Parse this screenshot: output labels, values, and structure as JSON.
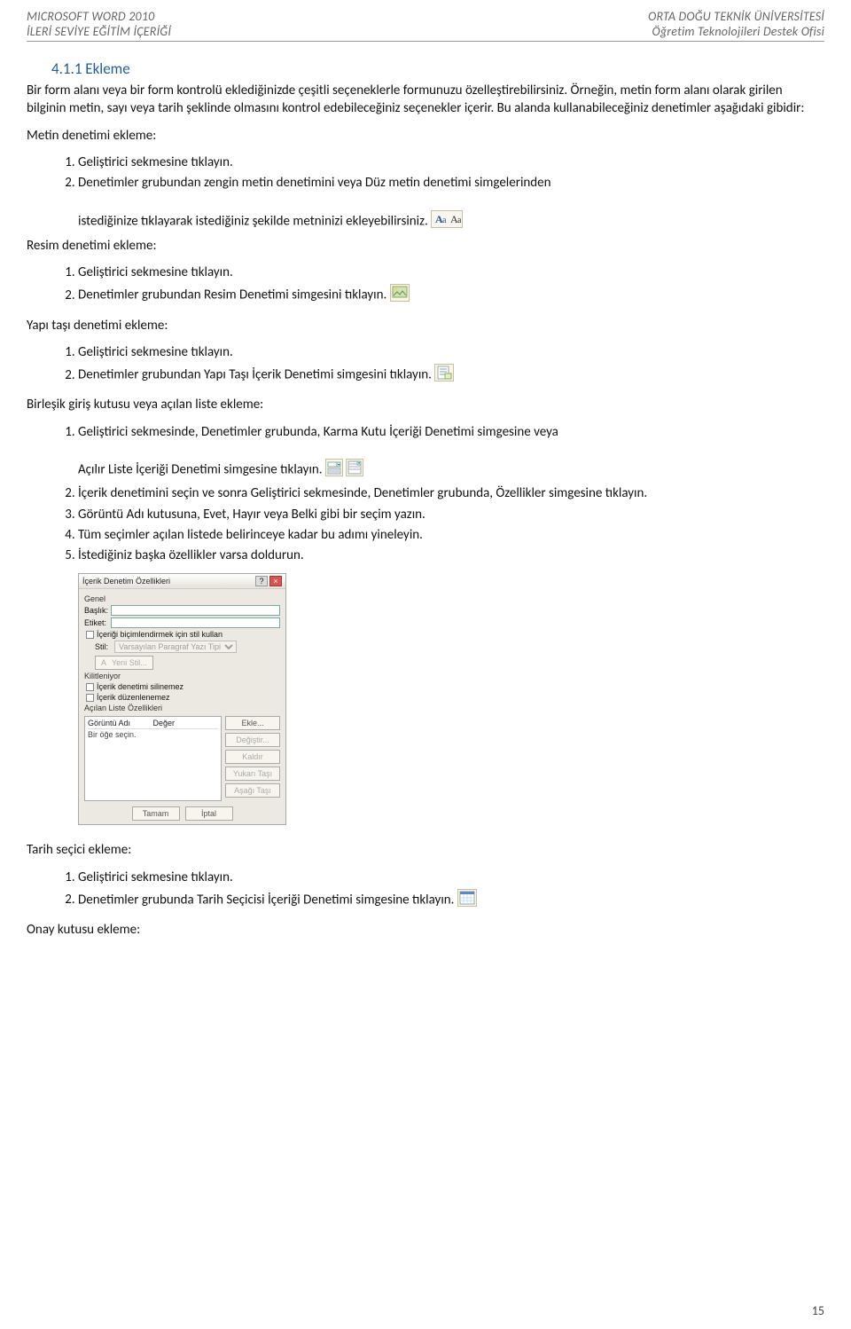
{
  "header": {
    "left_line1": "MICROSOFT WORD 2010",
    "left_line2": "İLERİ SEVİYE EĞİTİM İÇERİĞİ",
    "right_line1": "ORTA DOĞU TEKNİK ÜNİVERSİTESİ",
    "right_line2": "Öğretim Teknolojileri Destek Ofisi"
  },
  "section": {
    "number_title": "4.1.1 Ekleme",
    "intro": "Bir form alanı veya bir form kontrolü eklediğinizde çeşitli seçeneklerle formunuzu özelleştirebilirsiniz. Örneğin, metin form alanı olarak girilen bilginin metin, sayı veya tarih şeklinde olmasını kontrol edebileceğiniz seçenekler içerir. Bu alanda kullanabileceğiniz denetimler aşağıdaki gibidir:"
  },
  "metin": {
    "heading": "Metin denetimi ekleme:",
    "item1": "Geliştirici sekmesine tıklayın.",
    "item2_a": "Denetimler grubundan zengin metin denetimini veya Düz metin denetimi simgelerinden",
    "item2_b": "istediğinize tıklayarak istediğiniz şekilde metninizi ekleyebilirsiniz."
  },
  "resim": {
    "heading": "Resim denetimi ekleme:",
    "item1": "Geliştirici sekmesine tıklayın.",
    "item2": "Denetimler grubundan Resim Denetimi simgesini tıklayın."
  },
  "yapi": {
    "heading": "Yapı taşı denetimi ekleme:",
    "item1": "Geliştirici sekmesine tıklayın.",
    "item2": "Denetimler grubundan Yapı Taşı İçerik Denetimi simgesini tıklayın."
  },
  "birlesik": {
    "heading": "Birleşik giriş kutusu veya açılan liste ekleme:",
    "item1_a": "Geliştirici sekmesinde, Denetimler grubunda, Karma Kutu İçeriği Denetimi simgesine veya",
    "item1_b": "Açılır Liste İçeriği Denetimi simgesine tıklayın.",
    "item2": "İçerik denetimini seçin ve sonra Geliştirici sekmesinde, Denetimler grubunda, Özellikler simgesine tıklayın.",
    "item3": "Görüntü Adı kutusuna, Evet, Hayır veya Belki gibi bir seçim yazın.",
    "item4": "Tüm seçimler açılan listede belirinceye kadar bu adımı yineleyin.",
    "item5": "İstediğiniz başka özellikler varsa doldurun."
  },
  "dialog": {
    "title": "İçerik Denetim Özellikleri",
    "grp_genel": "Genel",
    "lbl_baslik": "Başlık:",
    "lbl_etiket": "Etiket:",
    "chk_stil": "İçeriği biçimlendirmek için stil kullan",
    "lbl_stil_sel": "Stil:",
    "stil_opt": "Varsayılan Paragraf Yazı Tipi",
    "btn_yeni_stil": "Yeni Stil...",
    "grp_kilit": "Kilitleniyor",
    "chk_silinemez": "İçerik denetimi silinemez",
    "chk_duzen": "İçerik düzenlenemez",
    "grp_acilan": "Açılan Liste Özellikleri",
    "col_ad": "Görüntü Adı",
    "col_deger": "Değer",
    "row_hint": "Bir öğe seçin.",
    "btn_ekle": "Ekle...",
    "btn_degistir": "Değiştir...",
    "btn_kaldir": "Kaldır",
    "btn_yukari": "Yukarı Taşı",
    "btn_asagi": "Aşağı Taşı",
    "btn_tamam": "Tamam",
    "btn_iptal": "İptal"
  },
  "tarih": {
    "heading": "Tarih seçici ekleme:",
    "item1": "Geliştirici sekmesine tıklayın.",
    "item2": "Denetimler grubunda Tarih Seçicisi İçeriği Denetimi simgesine tıklayın."
  },
  "onay": {
    "heading": "Onay kutusu ekleme:"
  },
  "page_number": "15"
}
